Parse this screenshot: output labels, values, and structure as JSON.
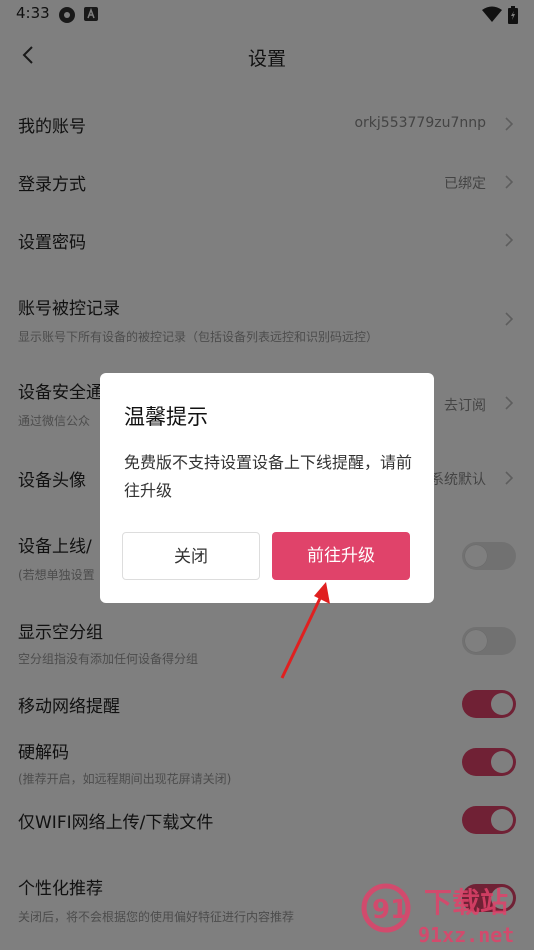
{
  "status_bar": {
    "time": "4:33"
  },
  "header": {
    "title": "设置"
  },
  "settings": {
    "account": {
      "label": "我的账号",
      "value": "orkj553779zu7nnp"
    },
    "login": {
      "label": "登录方式",
      "value": "已绑定"
    },
    "password": {
      "label": "设置密码"
    },
    "control_log": {
      "label": "账号被控记录",
      "sub": "显示账号下所有设备的被控记录（包括设备列表远控和识别码远控）"
    },
    "security": {
      "label": "设备安全通",
      "sub": "通过微信公众",
      "value": "去订阅"
    },
    "avatar": {
      "label": "设备头像",
      "value": "系统默认"
    },
    "online": {
      "label": "设备上线/",
      "sub": "(若想单独设置",
      "on": false
    },
    "empty_group": {
      "label": "显示空分组",
      "sub": "空分组指没有添加任何设备得分组",
      "on": false
    },
    "mobile_net": {
      "label": "移动网络提醒",
      "on": true
    },
    "hw_decode": {
      "label": "硬解码",
      "sub": "(推荐开启，如远程期间出现花屏请关闭)",
      "on": true
    },
    "wifi_only": {
      "label": "仅WIFI网络上传/下载文件",
      "on": true
    },
    "personal": {
      "label": "个性化推荐",
      "sub": "关闭后，将不会根据您的使用偏好特征进行内容推荐",
      "on": true
    }
  },
  "dialog": {
    "title": "温馨提示",
    "message": "免费版不支持设置设备上下线提醒，请前往升级",
    "close_label": "关闭",
    "upgrade_label": "前往升级"
  },
  "watermark": {
    "brand": "下载站",
    "site": "91xz.net"
  },
  "colors": {
    "accent": "#e0436a",
    "arrow": "#e02020"
  }
}
